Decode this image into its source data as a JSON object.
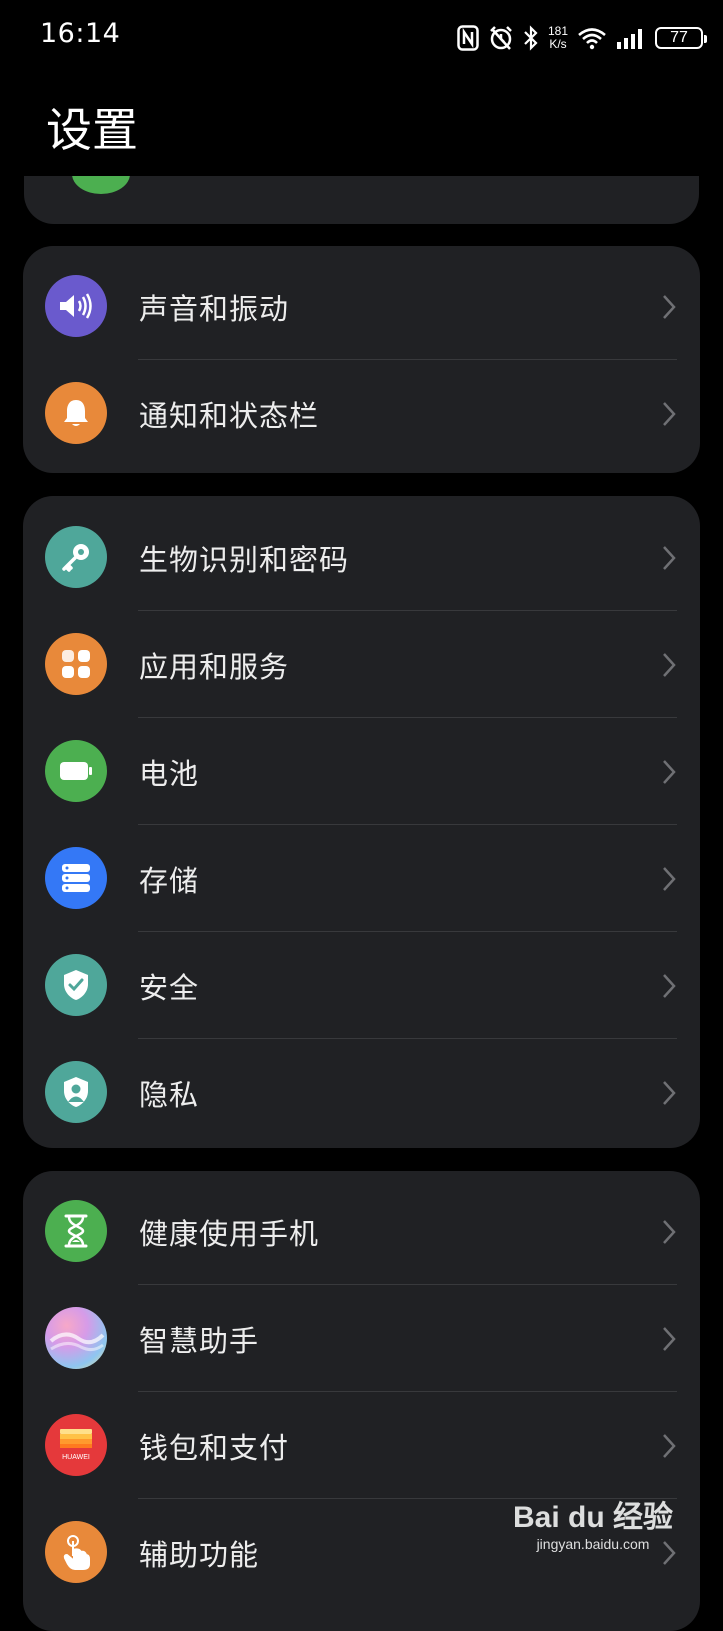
{
  "status_bar": {
    "time": "16:14",
    "net_speed_value": "181",
    "net_speed_unit": "K/s",
    "battery": "77",
    "icons": [
      "nfc-icon",
      "alarm-icon",
      "bluetooth-icon",
      "wifi-icon",
      "signal-icon",
      "battery-icon"
    ]
  },
  "header": {
    "title": "设置"
  },
  "groups": [
    {
      "items": [
        {
          "label": "声音和振动",
          "icon": "speaker-icon",
          "color": "#6A5ACD"
        },
        {
          "label": "通知和状态栏",
          "icon": "bell-icon",
          "color": "#E8893A"
        }
      ]
    },
    {
      "items": [
        {
          "label": "生物识别和密码",
          "icon": "key-icon",
          "color": "#4FA79A"
        },
        {
          "label": "应用和服务",
          "icon": "apps-icon",
          "color": "#E8893A"
        },
        {
          "label": "电池",
          "icon": "battery-icon",
          "color": "#4CAF50"
        },
        {
          "label": "存储",
          "icon": "storage-icon",
          "color": "#3478F6"
        },
        {
          "label": "安全",
          "icon": "shield-check-icon",
          "color": "#4FA79A"
        },
        {
          "label": "隐私",
          "icon": "privacy-icon",
          "color": "#4FA79A"
        }
      ]
    },
    {
      "items": [
        {
          "label": "健康使用手机",
          "icon": "hourglass-icon",
          "color": "#4CAF50"
        },
        {
          "label": "智慧助手",
          "icon": "assistant-icon",
          "color": "#C6A0E0"
        },
        {
          "label": "钱包和支付",
          "icon": "wallet-icon",
          "color": "#E5393B"
        },
        {
          "label": "辅助功能",
          "icon": "accessibility-icon",
          "color": "#E8893A"
        }
      ]
    }
  ],
  "watermark": {
    "brand": "Bai du 经验",
    "sub": "jingyan.baidu.com"
  },
  "wallet_icon_text": "HUAWEI"
}
